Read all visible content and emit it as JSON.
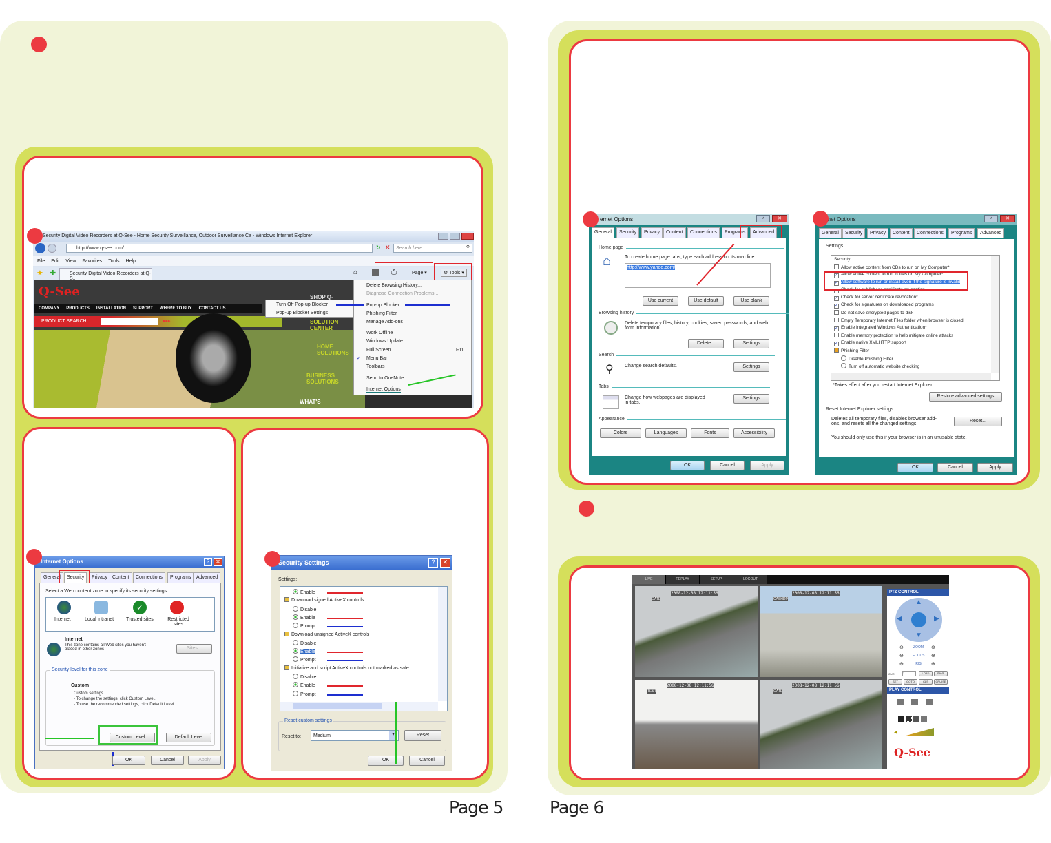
{
  "colors": {
    "page_bg": "#f1f4d8",
    "frame_green": "#d5df5b",
    "accent_red": "#ec3a41"
  },
  "pages": {
    "left": "Page 5",
    "right": "Page 6"
  },
  "ie_browser": {
    "title": "Security Digital Video Recorders at Q-See - Home Security Surveillance, Outdoor Surveillance Ca - Windows Internet Explorer",
    "url": "http://www.q-see.com/",
    "search_placeholder": "Search here",
    "menu": [
      "File",
      "Edit",
      "View",
      "Favorites",
      "Tools",
      "Help"
    ],
    "tab_title": "Security Digital Video Recorders at Q-S...",
    "page_label": "Page",
    "tools_label": "Tools",
    "site": {
      "logo": "Q-See",
      "nav": [
        "COMPANY",
        "PRODUCTS",
        "INSTALLATION",
        "SUPPORT",
        "WHERE TO BUY",
        "CONTACT US"
      ],
      "search_label": "PRODUCT SEARCH:",
      "side": [
        "SHOP Q-",
        "SOLUTION CENTER",
        "HOME SOLUTIONS",
        "BUSINESS SOLUTIONS",
        "WHAT'S"
      ]
    },
    "tools_menu": [
      "Delete Browsing History...",
      "Diagnose Connection Problems...",
      "Pop-up Blocker",
      "Phishing Filter",
      "Manage Add-ons",
      "Work Offline",
      "Windows Update",
      "Full Screen",
      "Menu Bar",
      "Toolbars",
      "Send to OneNote",
      "Internet Options"
    ],
    "full_screen_key": "F11",
    "popup_submenu": [
      "Turn Off Pop-up Blocker",
      "Pop-up Blocker Settings"
    ]
  },
  "xp_options": {
    "title": "Internet Options",
    "tabs": [
      "General",
      "Security",
      "Privacy",
      "Content",
      "Connections",
      "Programs",
      "Advanced"
    ],
    "prompt": "Select a Web content zone to specify its security settings.",
    "zones": [
      "Internet",
      "Local intranet",
      "Trusted sites",
      "Restricted sites"
    ],
    "zone_title": "Internet",
    "zone_desc": "This zone contains all Web sites you haven't placed in other zones",
    "sites_button": "Sites...",
    "level_group": "Security level for this zone",
    "level_name": "Custom",
    "level_desc": [
      "Custom settings",
      "- To change the settings, click Custom Level.",
      "- To use the recommended settings, click Default Level."
    ],
    "custom_level": "Custom Level...",
    "default_level": "Default Level",
    "ok": "OK",
    "cancel": "Cancel",
    "apply": "Apply"
  },
  "security_settings": {
    "title": "Security Settings",
    "settings_label": "Settings:",
    "items": [
      {
        "type": "radio",
        "label": "Enable",
        "checked": true
      },
      {
        "type": "head",
        "label": "Download signed ActiveX controls"
      },
      {
        "type": "radio",
        "label": "Disable",
        "checked": false
      },
      {
        "type": "radio",
        "label": "Enable",
        "checked": true
      },
      {
        "type": "radio",
        "label": "Prompt",
        "checked": false
      },
      {
        "type": "head",
        "label": "Download unsigned ActiveX controls"
      },
      {
        "type": "radio",
        "label": "Disable",
        "checked": false
      },
      {
        "type": "radio",
        "label": "Enable",
        "checked": true
      },
      {
        "type": "radio",
        "label": "Prompt",
        "checked": false
      },
      {
        "type": "head",
        "label": "Initialize and script ActiveX controls not marked as safe"
      },
      {
        "type": "radio",
        "label": "Disable",
        "checked": false
      },
      {
        "type": "radio",
        "label": "Enable",
        "checked": true
      },
      {
        "type": "radio",
        "label": "Prompt",
        "checked": false
      }
    ],
    "reset_group": "Reset custom settings",
    "reset_to": "Reset to:",
    "reset_value": "Medium",
    "reset": "Reset",
    "ok": "OK",
    "cancel": "Cancel"
  },
  "general_options": {
    "title": "ernet Options",
    "tabs": [
      "General",
      "Security",
      "Privacy",
      "Content",
      "Connections",
      "Programs",
      "Advanced"
    ],
    "home_page": "Home page",
    "home_desc": "To create home page tabs, type each address on its own line.",
    "home_url": "http://www.yahoo.com/",
    "use_current": "Use current",
    "use_default": "Use default",
    "use_blank": "Use blank",
    "browsing_history": "Browsing history",
    "history_desc": "Delete temporary files, history, cookies, saved passwords, and web form information.",
    "delete": "Delete...",
    "settings": "Settings",
    "search": "Search",
    "search_desc": "Change search defaults.",
    "tabs_label": "Tabs",
    "tabs_desc": "Change how webpages are displayed in tabs.",
    "appearance": "Appearance",
    "appearance_buttons": [
      "Colors",
      "Languages",
      "Fonts",
      "Accessibility"
    ],
    "ok": "OK",
    "cancel": "Cancel",
    "apply": "Apply"
  },
  "advanced_options": {
    "title": "rnet Options",
    "tabs": [
      "General",
      "Security",
      "Privacy",
      "Content",
      "Connections",
      "Programs",
      "Advanced"
    ],
    "settings_label": "Settings",
    "group": "Security",
    "items": [
      {
        "label": "Allow active content from CDs to run on My Computer*",
        "checked": false
      },
      {
        "label": "Allow active content to run in files on My Computer*",
        "checked": true
      },
      {
        "label": "Allow software to run or install even if the signature is invalid",
        "checked": true
      },
      {
        "label": "Check for publisher's certificate revocation",
        "checked": true
      },
      {
        "label": "Check for server certificate revocation*",
        "checked": true
      },
      {
        "label": "Check for signatures on downloaded programs",
        "checked": true
      },
      {
        "label": "Do not save encrypted pages to disk",
        "checked": false
      },
      {
        "label": "Empty Temporary Internet Files folder when browser is closed",
        "checked": false
      },
      {
        "label": "Enable Integrated Windows Authentication*",
        "checked": true
      },
      {
        "label": "Enable memory protection to help mitigate online attacks",
        "checked": false
      },
      {
        "label": "Enable native XMLHTTP support",
        "checked": true
      }
    ],
    "phishing": "Phishing Filter",
    "phishing_opts": [
      "Disable Phishing Filter",
      "Turn off automatic website checking"
    ],
    "note": "*Takes effect after you restart Internet Explorer",
    "restore": "Restore advanced settings",
    "reset_group": "Reset Internet Explorer settings",
    "reset_desc": "Deletes all temporary files, disables browser add-ons, and resets all the changed settings.",
    "reset": "Reset...",
    "warning": "You should only use this if your browser is in an unusable state.",
    "ok": "OK",
    "cancel": "Cancel",
    "apply": "Apply"
  },
  "dvr": {
    "tabs": [
      "LIVE",
      "REPLAY",
      "SETUP",
      "LOGOUT"
    ],
    "cameras": [
      {
        "label": "GATE",
        "time": "2008-12-08 12:11:56"
      },
      {
        "label": "CASHDP",
        "time": "2008-12-08 12:11:56"
      },
      {
        "label": "TEST",
        "time": "2008-12-08 12:11:56"
      },
      {
        "label": "GATE",
        "time": "2008-12-08 12:11:56"
      }
    ],
    "ptz_title": "PTZ CONTROL",
    "ptz_rows": [
      "ZOOM",
      "FOCUS",
      "IRIS"
    ],
    "cur_label": "CUR",
    "cur_value": "1",
    "ptz_buttons": [
      "LOAD",
      "SAVE",
      "SET",
      "GOTO",
      "CLS",
      "CRUISE"
    ],
    "play_title": "PLAY CONTROL",
    "logo": "Q-See"
  }
}
